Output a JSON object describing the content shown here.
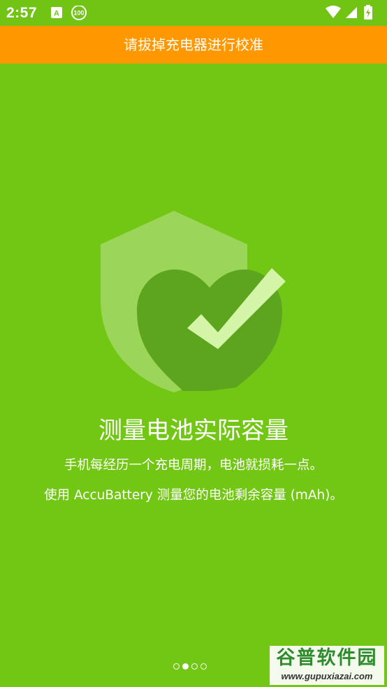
{
  "status_bar": {
    "time": "2:57",
    "notification_badge_text": "100",
    "icons": [
      "a-letter-icon",
      "battery-100-notification-icon",
      "wifi-icon",
      "signal-icon",
      "battery-charging-icon"
    ]
  },
  "banner": {
    "text": "请拔掉充电器进行校准"
  },
  "onboarding": {
    "title": "测量电池实际容量",
    "desc_line1": "手机每经历一个充电周期，电池就损耗一点。",
    "desc_line2": "使用 AccuBattery 测量您的电池剩余容量 (mAh)。",
    "page_indicator": {
      "total": 4,
      "current": 2
    }
  },
  "watermark": {
    "title": "谷普软件园",
    "url": "www.gupuxiazai.com"
  },
  "colors": {
    "background": "#72c614",
    "banner": "#ff9800",
    "shield": "#9bd65a",
    "heart": "#5da51e",
    "check": "#d4f5a8"
  }
}
